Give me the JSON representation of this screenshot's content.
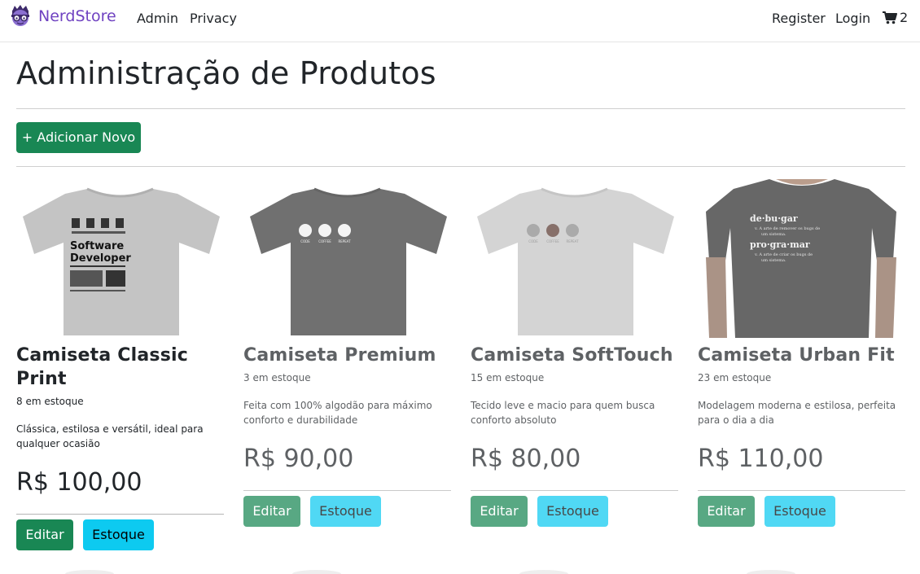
{
  "navbar": {
    "brand": "NerdStore",
    "logo_icon": "nerd-face-logo-icon",
    "links": [
      {
        "label": "Admin"
      },
      {
        "label": "Privacy"
      }
    ],
    "register": "Register",
    "login": "Login",
    "cart_icon": "shopping-cart-icon",
    "cart_count": "2"
  },
  "page": {
    "title": "Administração de Produtos",
    "add_button": "+ Adicionar Novo"
  },
  "products": [
    {
      "name": "Camiseta Classic Print",
      "stock": "8 em estoque",
      "description": "Clássica, estilosa e versátil, ideal para qualquer ocasião",
      "price": "R$ 100,00",
      "edit": "Editar",
      "stock_button": "Estoque",
      "shirt_color": "#c4c4c4",
      "print_text": [
        "Software",
        "Developer"
      ]
    },
    {
      "name": "Camiseta Premium",
      "stock": "3 em estoque",
      "description": "Feita com 100% algodão para máximo conforto e durabilidade",
      "price": "R$ 90,00",
      "edit": "Editar",
      "stock_button": "Estoque",
      "shirt_color": "#3a3a3a",
      "print_text": [
        "CODE",
        "COFFEE",
        "REPEAT"
      ]
    },
    {
      "name": "Camiseta SoftTouch",
      "stock": "15 em estoque",
      "description": "Tecido leve e macio para quem busca conforto absoluto",
      "price": "R$ 80,00",
      "edit": "Editar",
      "stock_button": "Estoque",
      "shirt_color": "#c4c4c4",
      "print_text": [
        "CODE",
        "COFFEE",
        "REPEAT"
      ]
    },
    {
      "name": "Camiseta Urban Fit",
      "stock": "23 em estoque",
      "description": "Modelagem moderna e estilosa, perfeita para o dia a dia",
      "price": "R$ 110,00",
      "edit": "Editar",
      "stock_button": "Estoque",
      "shirt_color": "#2e2e2e",
      "print_text": [
        "de·bu·gar",
        "v. A arte de remover os bugs de",
        "um sistema.",
        "pro·gra·mar",
        "v. A arte de criar os bugs de",
        "um sistema."
      ]
    }
  ],
  "colors": {
    "brand": "#6f42c1",
    "success": "#198754",
    "info": "#0dcaf0"
  }
}
